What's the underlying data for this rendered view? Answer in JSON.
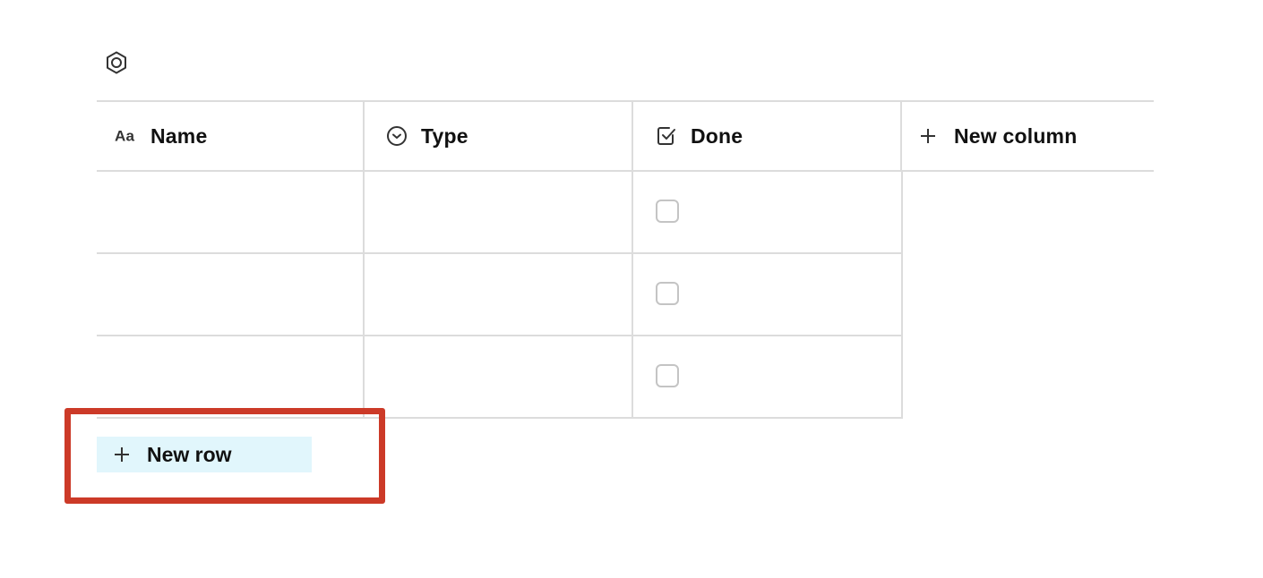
{
  "toolbar": {
    "settings_icon": "settings-hexagon-icon"
  },
  "table": {
    "columns": [
      {
        "label": "Name",
        "icon": "text-aa-icon"
      },
      {
        "label": "Type",
        "icon": "select-circle-chevron-icon"
      },
      {
        "label": "Done",
        "icon": "checkbox-checked-icon"
      }
    ],
    "new_column": {
      "label": "New column",
      "icon": "plus-icon"
    },
    "rows": [
      {
        "name": "",
        "type": "",
        "done": false
      },
      {
        "name": "",
        "type": "",
        "done": false
      },
      {
        "name": "",
        "type": "",
        "done": false
      }
    ],
    "new_row": {
      "label": "New row",
      "icon": "plus-icon"
    }
  },
  "colors": {
    "highlight": "#cc3a28",
    "new_row_background": "#e1f6fc",
    "grid_line": "#dcdcdc"
  }
}
